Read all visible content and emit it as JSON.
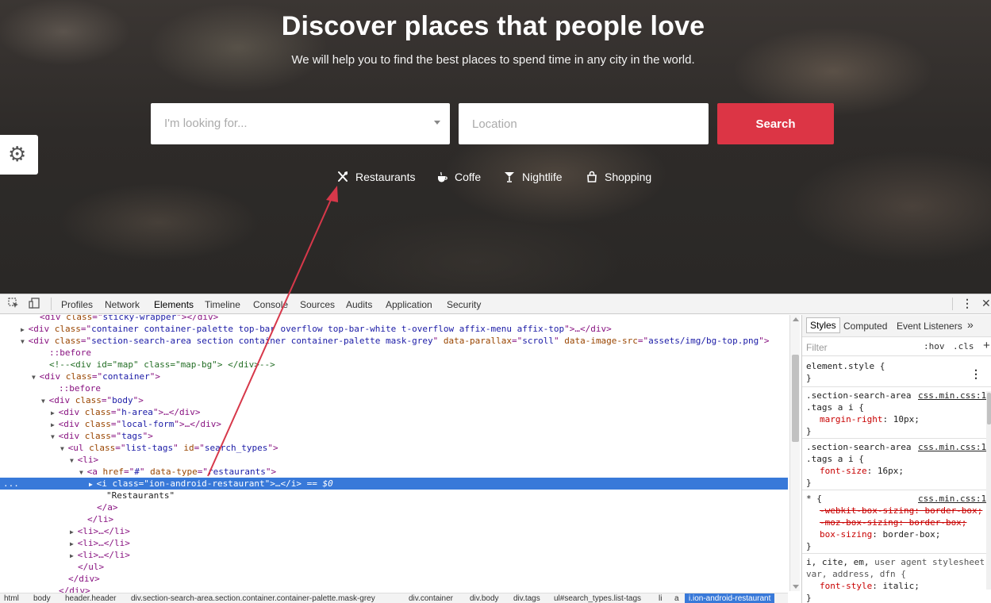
{
  "hero": {
    "title": "Discover places that people love",
    "subtitle": "We will help you to find the best places to spend time in any city in the world."
  },
  "search": {
    "what_placeholder": "I'm looking for...",
    "where_placeholder": "Location",
    "button_label": "Search"
  },
  "tags": [
    {
      "label": "Restaurants",
      "icon": "fork-knife-icon"
    },
    {
      "label": "Coffe",
      "icon": "coffee-icon"
    },
    {
      "label": "Nightlife",
      "icon": "cocktail-icon"
    },
    {
      "label": "Shopping",
      "icon": "shopping-bag-icon"
    }
  ],
  "settings_icon": "gear-icon",
  "colors": {
    "accent": "#dc3545",
    "annotation_arrow": "#d7384a",
    "selection": "#3879d9"
  },
  "devtools": {
    "tabs": [
      "Profiles",
      "Network",
      "Elements",
      "Timeline",
      "Console",
      "Sources",
      "Audits",
      "Application",
      "Security"
    ],
    "active_tab": "Elements",
    "dom_lines": [
      {
        "tri": "",
        "parts": [
          [
            "t",
            "<div "
          ],
          [
            "a",
            "class"
          ],
          [
            "t",
            "=\""
          ],
          [
            "v",
            "sticky-wrapper"
          ],
          [
            "t",
            "\"></div>"
          ]
        ]
      },
      {
        "tri": "▶",
        "parts": [
          [
            "t",
            "<div "
          ],
          [
            "a",
            "class"
          ],
          [
            "t",
            "=\""
          ],
          [
            "v",
            "container container-palette top-bar overflow top-bar-white t-overflow affix-menu affix-top"
          ],
          [
            "t",
            "\">…</div>"
          ]
        ]
      },
      {
        "tri": "▼",
        "parts": [
          [
            "t",
            "<div "
          ],
          [
            "a",
            "class"
          ],
          [
            "t",
            "=\""
          ],
          [
            "v",
            "section-search-area section container container-palette mask-grey"
          ],
          [
            "t",
            "\" "
          ],
          [
            "a",
            "data-parallax"
          ],
          [
            "t",
            "=\""
          ],
          [
            "v",
            "scroll"
          ],
          [
            "t",
            "\" "
          ],
          [
            "a",
            "data-image-src"
          ],
          [
            "t",
            "=\""
          ],
          [
            "v",
            "assets/img/bg-top.png"
          ],
          [
            "t",
            "\">"
          ]
        ]
      },
      {
        "tri": "",
        "parts": [
          [
            "t",
            "::before"
          ]
        ]
      },
      {
        "tri": "",
        "parts": [
          [
            "c",
            "<!--<div id=\"map\" class=\"map-bg\"> </div>-->"
          ]
        ]
      },
      {
        "tri": "▼",
        "parts": [
          [
            "t",
            "<div "
          ],
          [
            "a",
            "class"
          ],
          [
            "t",
            "=\""
          ],
          [
            "v",
            "container"
          ],
          [
            "t",
            "\">"
          ]
        ]
      },
      {
        "tri": "",
        "parts": [
          [
            "t",
            "::before"
          ]
        ]
      },
      {
        "tri": "▼",
        "parts": [
          [
            "t",
            "<div "
          ],
          [
            "a",
            "class"
          ],
          [
            "t",
            "=\""
          ],
          [
            "v",
            "body"
          ],
          [
            "t",
            "\">"
          ]
        ]
      },
      {
        "tri": "▶",
        "parts": [
          [
            "t",
            "<div "
          ],
          [
            "a",
            "class"
          ],
          [
            "t",
            "=\""
          ],
          [
            "v",
            "h-area"
          ],
          [
            "t",
            "\">…</div>"
          ]
        ]
      },
      {
        "tri": "▶",
        "parts": [
          [
            "t",
            "<div "
          ],
          [
            "a",
            "class"
          ],
          [
            "t",
            "=\""
          ],
          [
            "v",
            "local-form"
          ],
          [
            "t",
            "\">…</div>"
          ]
        ]
      },
      {
        "tri": "▼",
        "parts": [
          [
            "t",
            "<div "
          ],
          [
            "a",
            "class"
          ],
          [
            "t",
            "=\""
          ],
          [
            "v",
            "tags"
          ],
          [
            "t",
            "\">"
          ]
        ]
      },
      {
        "tri": "▼",
        "parts": [
          [
            "t",
            "<ul "
          ],
          [
            "a",
            "class"
          ],
          [
            "t",
            "=\""
          ],
          [
            "v",
            "list-tags"
          ],
          [
            "t",
            "\" "
          ],
          [
            "a",
            "id"
          ],
          [
            "t",
            "=\""
          ],
          [
            "v",
            "search_types"
          ],
          [
            "t",
            "\">"
          ]
        ]
      },
      {
        "tri": "▼",
        "parts": [
          [
            "t",
            "<li>"
          ]
        ]
      },
      {
        "tri": "▼",
        "parts": [
          [
            "t",
            "<a "
          ],
          [
            "a",
            "href"
          ],
          [
            "t",
            "=\""
          ],
          [
            "v",
            "#"
          ],
          [
            "t",
            "\" "
          ],
          [
            "a",
            "data-type"
          ],
          [
            "t",
            "=\""
          ],
          [
            "v",
            "restaurants"
          ],
          [
            "t",
            "\">"
          ]
        ]
      },
      {
        "tri": "▶",
        "parts": [
          [
            "t",
            "<i "
          ],
          [
            "a",
            "class"
          ],
          [
            "t",
            "=\""
          ],
          [
            "v",
            "ion-android-restaurant"
          ],
          [
            "t",
            "\">…</i>"
          ],
          [
            "x",
            " == $0"
          ]
        ]
      },
      {
        "tri": "",
        "parts": [
          [
            "x",
            "\"Restaurants\""
          ]
        ]
      },
      {
        "tri": "",
        "parts": [
          [
            "t",
            "</a>"
          ]
        ]
      },
      {
        "tri": "",
        "parts": [
          [
            "t",
            "</li>"
          ]
        ]
      },
      {
        "tri": "▶",
        "parts": [
          [
            "t",
            "<li>…</li>"
          ]
        ]
      },
      {
        "tri": "▶",
        "parts": [
          [
            "t",
            "<li>…</li>"
          ]
        ]
      },
      {
        "tri": "▶",
        "parts": [
          [
            "t",
            "<li>…</li>"
          ]
        ]
      },
      {
        "tri": "",
        "parts": [
          [
            "t",
            "</ul>"
          ]
        ]
      },
      {
        "tri": "",
        "parts": [
          [
            "t",
            "</div>"
          ]
        ]
      },
      {
        "tri": "",
        "parts": [
          [
            "t",
            "</div>"
          ]
        ]
      }
    ],
    "selected_dots": "...",
    "breadcrumbs": [
      "html",
      "body",
      "header.header",
      "div.section-search-area.section.container.container-palette.mask-grey",
      "div.container",
      "div.body",
      "div.tags",
      "ul#search_types.list-tags",
      "li",
      "a",
      "i.ion-android-restaurant"
    ],
    "styles": {
      "tabs": [
        "Styles",
        "Computed",
        "Event Listeners"
      ],
      "more": "»",
      "filter_placeholder": "Filter",
      "hov": ":hov",
      "cls": ".cls",
      "add": "+",
      "element_style": "element.style {",
      "close_brace": "}",
      "rules": [
        {
          "selector1": ".section-search-area",
          "selector2": ".tags a i {",
          "source": "css.min.css:1",
          "prop": "margin-right",
          "value": "10px;"
        },
        {
          "selector1": ".section-search-area",
          "selector2": ".tags a i {",
          "source": "css.min.css:1",
          "prop": "font-size",
          "value": "16px;"
        }
      ],
      "universal": {
        "selector": "* {",
        "source": "css.min.css:1",
        "struck": [
          "-webkit-box-sizing: border-box;",
          "-moz-box-sizing: border-box;"
        ],
        "prop": "box-sizing",
        "value": "border-box;"
      },
      "ua_selector": "i, cite, em,",
      "ua_label": "user agent stylesheet",
      "ua_selector2": "var, address, dfn {",
      "ua_prop": "font-style",
      "ua_value": "italic;"
    }
  }
}
